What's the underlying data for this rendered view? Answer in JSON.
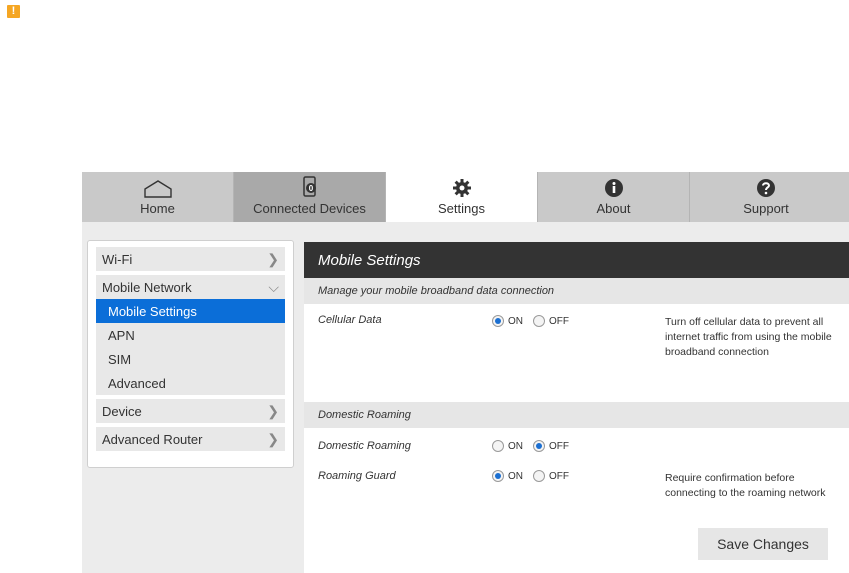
{
  "alert": {
    "glyph": "!"
  },
  "nav": {
    "tabs": [
      {
        "label": "Home",
        "icon": "home-icon"
      },
      {
        "label": "Connected Devices",
        "icon": "connected-devices-icon",
        "badge": "0"
      },
      {
        "label": "Settings",
        "icon": "gear-icon"
      },
      {
        "label": "About",
        "icon": "info-icon"
      },
      {
        "label": "Support",
        "icon": "help-icon"
      }
    ]
  },
  "sidebar": {
    "wifi": "Wi-Fi",
    "mobile_network": "Mobile Network",
    "mobile_settings": "Mobile Settings",
    "apn": "APN",
    "sim": "SIM",
    "advanced": "Advanced",
    "device": "Device",
    "advanced_router": "Advanced Router"
  },
  "panel": {
    "title": "Mobile Settings",
    "subtitle": "Manage your mobile broadband data connection",
    "cellular_data": {
      "label": "Cellular Data",
      "on": "ON",
      "off": "OFF",
      "selected": "ON",
      "description": "Turn off cellular data to prevent all internet traffic from using the mobile broadband connection"
    },
    "roaming_section": "Domestic Roaming",
    "domestic_roaming": {
      "label": "Domestic Roaming",
      "on": "ON",
      "off": "OFF",
      "selected": "OFF"
    },
    "roaming_guard": {
      "label": "Roaming Guard",
      "on": "ON",
      "off": "OFF",
      "selected": "ON",
      "description": "Require confirmation before connecting to the roaming network"
    },
    "save_label": "Save Changes"
  },
  "colors": {
    "accent": "#0b6ed8",
    "header": "#333333",
    "warning": "#f5a623"
  }
}
